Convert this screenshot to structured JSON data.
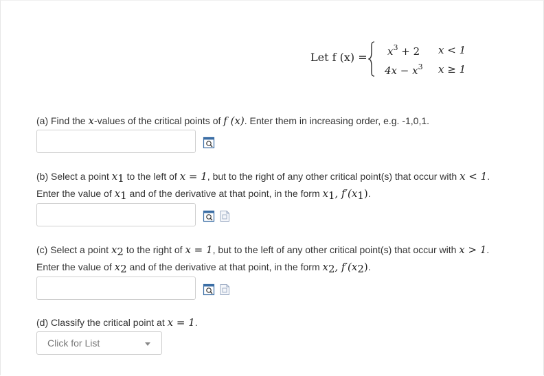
{
  "definition": {
    "lhs": "Let f (x) =",
    "piece1_expr": "x",
    "piece1_exp": "3",
    "piece1_rest": " + 2",
    "piece1_cond": "x < 1",
    "piece2_expr": "4x − x",
    "piece2_exp": "3",
    "piece2_cond": "x ≥ 1"
  },
  "part_a": {
    "text_1": "(a) Find the ",
    "math_x": "x",
    "text_2": "-values of the critical points of ",
    "math_fx": "f (x)",
    "text_3": ". Enter them in increasing order, e.g. -1,0,1.",
    "answer_value": ""
  },
  "part_b": {
    "line1_a": "(b) Select a point ",
    "x1": "x",
    "sub1": "1",
    "line1_b": " to the left of ",
    "eq1": "x = 1",
    "line1_c": ", but to the right of any other critical point(s) that occur with ",
    "cond": "x < 1",
    "line1_d": ".",
    "line2_a": "Enter the value of ",
    "line2_b": " and of the derivative at that point, in the form ",
    "form": "x",
    "form_sub": "1",
    "form_rest": ", f′(x",
    "form_sub2": "1",
    "form_end": ")",
    "line2_end": ".",
    "answer_value": ""
  },
  "part_c": {
    "line1_a": "(c) Select a point ",
    "x2": "x",
    "sub2": "2",
    "line1_b": " to the right of ",
    "eq1": "x = 1",
    "line1_c": ", but to the left of any other critical point(s) that occur with ",
    "cond": "x > 1",
    "line1_d": ".",
    "line2_a": "Enter the value of ",
    "line2_b": " and of the derivative at that point, in the form ",
    "form": "x",
    "form_sub": "2",
    "form_rest": ", f′(x",
    "form_sub2": "2",
    "form_end": ")",
    "line2_end": ".",
    "answer_value": ""
  },
  "part_d": {
    "text": "(d) Classify the critical point at ",
    "eq": "x = 1",
    "end": ".",
    "select_placeholder": "Click for List"
  },
  "icons": {
    "preview": "preview-magnifier-icon",
    "help": "help-document-icon"
  },
  "colors": {
    "border": "#cfcfcf",
    "text": "#333333",
    "icon_blue": "#3b6ea5"
  }
}
